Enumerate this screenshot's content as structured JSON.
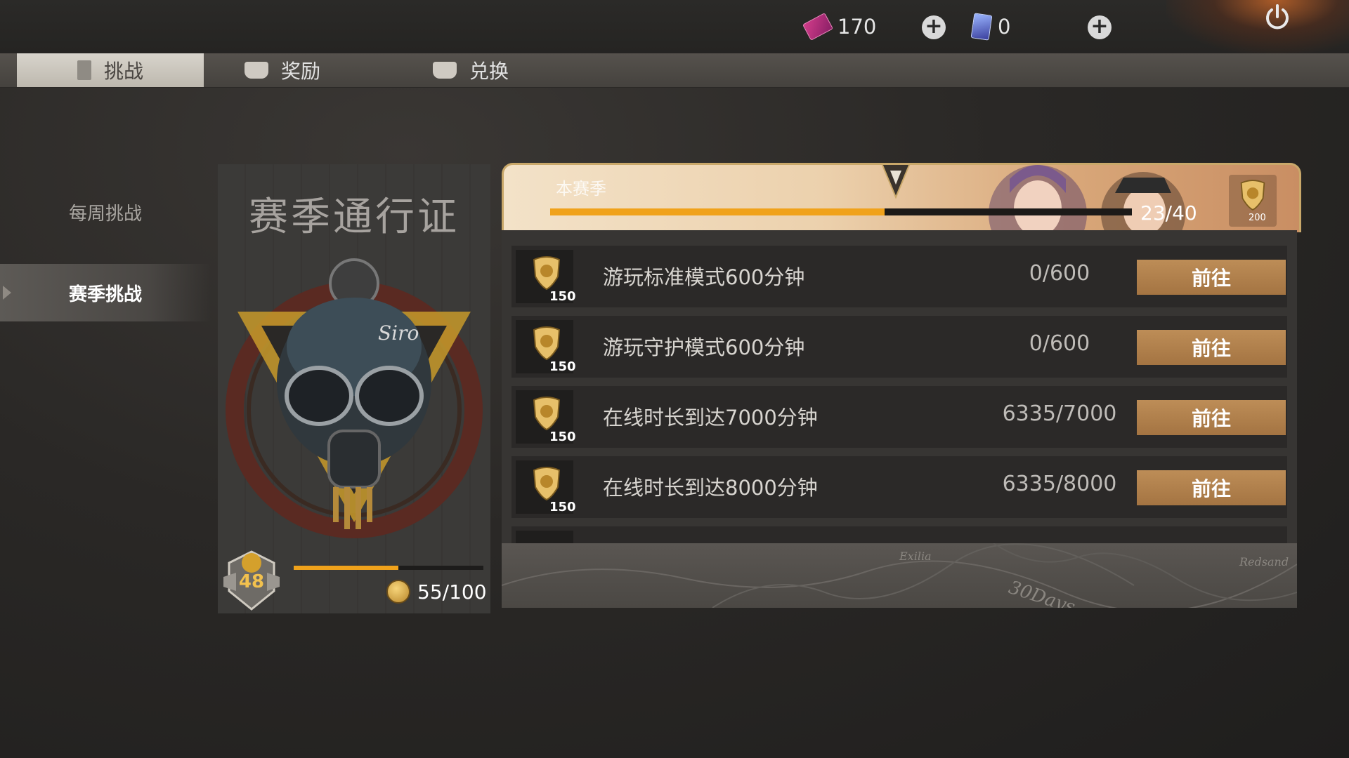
{
  "currencies": {
    "tickets": "170",
    "cards": "0"
  },
  "tabs": {
    "challenge": "挑战",
    "reward": "奖励",
    "exchange": "兑换"
  },
  "sidebar": {
    "weekly": "每周挑战",
    "season": "赛季挑战"
  },
  "pass": {
    "title": "赛季通行证",
    "level": "48",
    "progress_text": "55/100",
    "progress_fraction": 0.55,
    "art_text": "Siro"
  },
  "season_banner": {
    "label": "本赛季",
    "progress_text": "23/40",
    "progress_fraction": 0.575,
    "reward_value": "200"
  },
  "tasks": [
    {
      "title": "游玩标准模式600分钟",
      "progress": "0/600",
      "reward": "150",
      "button": "前往"
    },
    {
      "title": "游玩守护模式600分钟",
      "progress": "0/600",
      "reward": "150",
      "button": "前往"
    },
    {
      "title": "在线时长到达7000分钟",
      "progress": "6335/7000",
      "reward": "150",
      "button": "前往"
    },
    {
      "title": "在线时长到达8000分钟",
      "progress": "6335/8000",
      "reward": "150",
      "button": "前往"
    }
  ],
  "map": {
    "labels": [
      "Exilia",
      "30Days",
      "Redsand"
    ]
  },
  "colors": {
    "accent_orange": "#f0a21b",
    "button_brown": "#b07f4a",
    "gold": "#f2c14e"
  }
}
